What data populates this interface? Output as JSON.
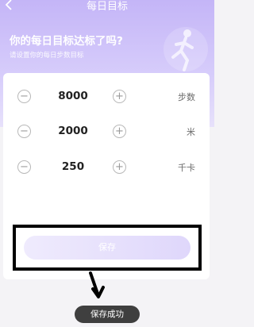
{
  "nav": {
    "title": "每日目标",
    "back_icon": "chevron-left-icon"
  },
  "hero": {
    "title": "你的每日目标达标了吗?",
    "subtitle": "请设置你的每日步数目标",
    "illustration": "runner-illustration-icon"
  },
  "goals": [
    {
      "value": "8000",
      "unit": "步数"
    },
    {
      "value": "2000",
      "unit": "米"
    },
    {
      "value": "250",
      "unit": "千卡"
    }
  ],
  "controls": {
    "minus_symbol": "−",
    "plus_symbol": "+"
  },
  "save_button": {
    "label": "保存"
  },
  "toast": {
    "message": "保存成功"
  },
  "colors": {
    "header_gradient_top": "#c4b5f7",
    "header_gradient_bottom": "#e7e1fb",
    "save_gradient_start": "#efebfd",
    "save_gradient_end": "#dfd7fb",
    "toast_bg": "#3f3f3f",
    "highlight_border": "#000000"
  }
}
